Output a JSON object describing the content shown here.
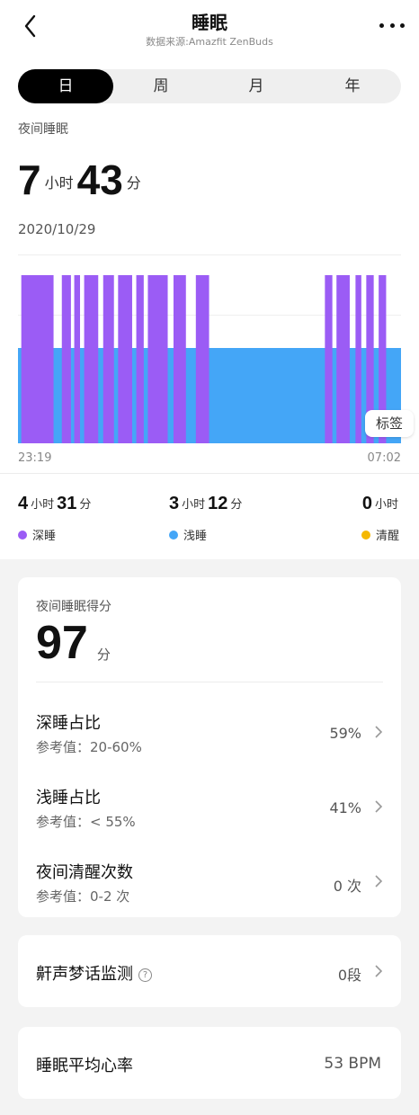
{
  "header": {
    "title": "睡眠",
    "subtitle": "数据来源:Amazfit ZenBuds"
  },
  "tabs": [
    {
      "label": "日",
      "active": true
    },
    {
      "label": "周",
      "active": false
    },
    {
      "label": "月",
      "active": false
    },
    {
      "label": "年",
      "active": false
    }
  ],
  "night_sleep": {
    "label": "夜间睡眠",
    "hours": "7",
    "hours_unit": "小时",
    "minutes": "43",
    "minutes_unit": "分",
    "date": "2020/10/29",
    "tag_button": "标签",
    "start_time": "23:19",
    "end_time": "07:02"
  },
  "chart_data": {
    "type": "timeline",
    "x_start": "23:19",
    "x_end": "07:02",
    "series": [
      {
        "name": "深睡",
        "color": "#9b5cf5",
        "level": "high"
      },
      {
        "name": "浅睡",
        "color": "#44a6f7",
        "level": "low"
      }
    ],
    "deep_sleep_segments": [
      {
        "start": "23:23",
        "end": "00:02"
      },
      {
        "start": "00:12",
        "end": "00:23"
      },
      {
        "start": "00:27",
        "end": "00:34"
      },
      {
        "start": "00:39",
        "end": "00:56"
      },
      {
        "start": "01:02",
        "end": "01:15"
      },
      {
        "start": "01:20",
        "end": "01:37"
      },
      {
        "start": "01:42",
        "end": "01:51"
      },
      {
        "start": "01:56",
        "end": "02:20"
      },
      {
        "start": "02:27",
        "end": "02:42"
      },
      {
        "start": "02:54",
        "end": "03:10"
      },
      {
        "start": "05:30",
        "end": "05:39"
      },
      {
        "start": "05:44",
        "end": "06:00"
      },
      {
        "start": "06:07",
        "end": "06:14"
      },
      {
        "start": "06:20",
        "end": "06:29"
      },
      {
        "start": "06:35",
        "end": "06:44"
      }
    ],
    "light_sleep_range": {
      "start": "23:19",
      "end": "07:02"
    },
    "colors": {
      "deep": "#9b5cf5",
      "light": "#44a6f7",
      "awake": "#f5b800"
    }
  },
  "stats": [
    {
      "hours": "4",
      "hours_unit": "小时",
      "minutes": "31",
      "minutes_unit": "分",
      "label": "深睡",
      "color": "#9b5cf5"
    },
    {
      "hours": "3",
      "hours_unit": "小时",
      "minutes": "12",
      "minutes_unit": "分",
      "label": "浅睡",
      "color": "#44a6f7"
    },
    {
      "hours": "0",
      "hours_unit": "小时",
      "label": "清醒",
      "color": "#f5b800"
    }
  ],
  "score_card": {
    "title": "夜间睡眠得分",
    "score": "97",
    "unit": "分",
    "rows": [
      {
        "name": "深睡占比",
        "ref": "参考值：20-60%",
        "value": "59%"
      },
      {
        "name": "浅睡占比",
        "ref": "参考值：< 55%",
        "value": "41%"
      },
      {
        "name": "夜间清醒次数",
        "ref": "参考值：0-2 次",
        "value": "0 次"
      }
    ]
  },
  "snore_card": {
    "label": "鼾声梦话监测",
    "help_glyph": "?",
    "value": "0段"
  },
  "heart_card": {
    "label": "睡眠平均心率",
    "value": "53 BPM"
  }
}
